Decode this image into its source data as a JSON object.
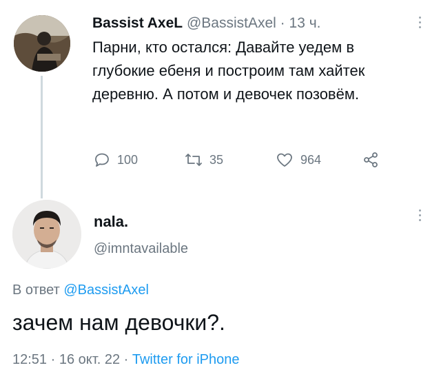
{
  "tweet": {
    "author_name": "Bassist AxeL",
    "author_handle": "@BassistAxel",
    "separator": "·",
    "time_ago": "13 ч.",
    "text": "Парни, кто остался: Давайте уедем в глубокие ебеня и построим там хайтек деревню. А потом и девочек позовём.",
    "replies": "100",
    "retweets": "35",
    "likes": "964"
  },
  "reply": {
    "author_name": "nala.",
    "author_handle": "@imntavailable",
    "reply_to_prefix": "В ответ",
    "reply_to_handle": "@BassistAxel",
    "text": "зачем нам девочки?.",
    "time": "12:51",
    "sep1": "·",
    "date": "16 окт. 22",
    "sep2": "·",
    "source": "Twitter for iPhone"
  },
  "colors": {
    "text": "#0f1419",
    "secondary": "#6b7680",
    "link": "#1d9bf0",
    "thread_line": "#cfd9de"
  },
  "icons": [
    "reply-icon",
    "retweet-icon",
    "like-icon",
    "share-icon",
    "more-icon"
  ]
}
